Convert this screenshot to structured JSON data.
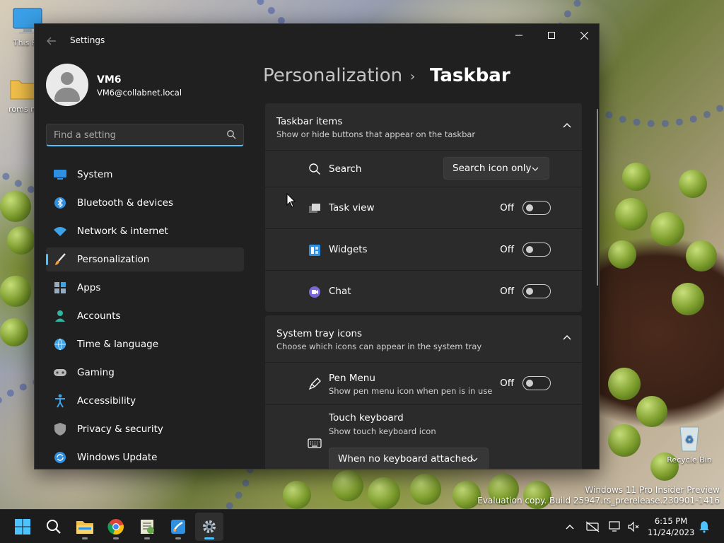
{
  "desktop": {
    "icons": [
      {
        "label": "This PC"
      },
      {
        "label": "roms m"
      },
      {
        "label": "Recycle Bin"
      }
    ],
    "watermark": {
      "line1": "Windows 11 Pro Insider Preview",
      "line2": "Evaluation copy. Build 25947.rs_prerelease.230901-1416"
    }
  },
  "window": {
    "title": "Settings",
    "controls": {
      "minimize": "minimize-icon",
      "maximize": "maximize-icon",
      "close": "close-icon"
    }
  },
  "profile": {
    "name": "VM6",
    "email": "VM6@collabnet.local"
  },
  "search": {
    "placeholder": "Find a setting",
    "value": ""
  },
  "sidebar": {
    "items": [
      {
        "label": "System",
        "icon": "monitor-icon",
        "active": false
      },
      {
        "label": "Bluetooth & devices",
        "icon": "bluetooth-icon",
        "active": false
      },
      {
        "label": "Network & internet",
        "icon": "wifi-icon",
        "active": false
      },
      {
        "label": "Personalization",
        "icon": "brush-icon",
        "active": true
      },
      {
        "label": "Apps",
        "icon": "apps-icon",
        "active": false
      },
      {
        "label": "Accounts",
        "icon": "person-icon",
        "active": false
      },
      {
        "label": "Time & language",
        "icon": "globe-clock-icon",
        "active": false
      },
      {
        "label": "Gaming",
        "icon": "gamepad-icon",
        "active": false
      },
      {
        "label": "Accessibility",
        "icon": "accessibility-icon",
        "active": false
      },
      {
        "label": "Privacy & security",
        "icon": "shield-icon",
        "active": false
      },
      {
        "label": "Windows Update",
        "icon": "update-icon",
        "active": false
      }
    ]
  },
  "breadcrumb": {
    "parent": "Personalization",
    "separator": "›",
    "current": "Taskbar"
  },
  "taskbar_items": {
    "title": "Taskbar items",
    "subtitle": "Show or hide buttons that appear on the taskbar",
    "search": {
      "label": "Search",
      "selected": "Search icon only"
    },
    "rows": [
      {
        "label": "Task view",
        "state": "Off",
        "on": false
      },
      {
        "label": "Widgets",
        "state": "Off",
        "on": false
      },
      {
        "label": "Chat",
        "state": "Off",
        "on": false
      }
    ]
  },
  "system_tray": {
    "title": "System tray icons",
    "subtitle": "Choose which icons can appear in the system tray",
    "pen_menu": {
      "label": "Pen Menu",
      "description": "Show pen menu icon when pen is in use",
      "state": "Off",
      "on": false
    },
    "touch_keyboard": {
      "label": "Touch keyboard",
      "description": "Show touch keyboard icon",
      "selected": "When no keyboard attached"
    }
  },
  "taskbar": {
    "apps": [
      "start-icon",
      "search-icon",
      "file-explorer-icon",
      "chrome-icon",
      "notepad-plus-icon",
      "paint-icon",
      "settings-icon"
    ],
    "clock": {
      "time": "6:15 PM",
      "date": "11/24/2023"
    }
  },
  "colors": {
    "accent": "#4cc2ff",
    "window_bg": "#202020",
    "card_bg": "#2b2b2b"
  }
}
